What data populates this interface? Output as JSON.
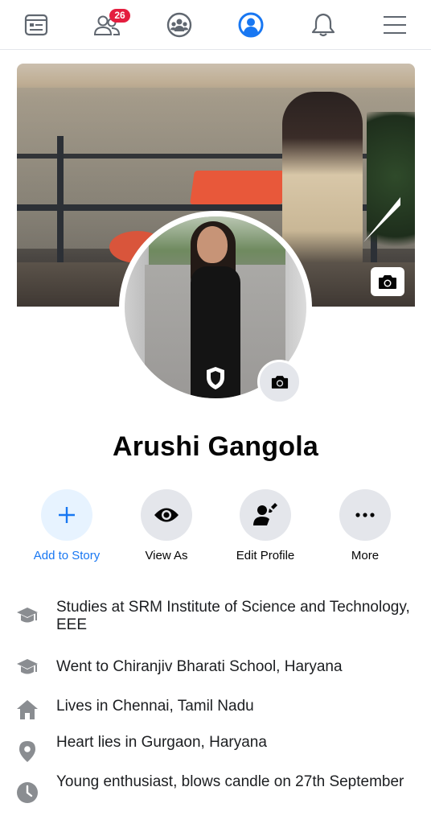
{
  "nav": {
    "items": [
      {
        "name": "news-feed-icon"
      },
      {
        "name": "friends-icon",
        "badge": "26"
      },
      {
        "name": "groups-icon"
      },
      {
        "name": "profile-icon",
        "active": true
      },
      {
        "name": "notifications-icon"
      },
      {
        "name": "menu-icon"
      }
    ],
    "accent_color": "#1877f2",
    "badge_color": "#e41e3f"
  },
  "profile": {
    "name": "Arushi Gangola"
  },
  "actions": [
    {
      "label": "Add to Story",
      "icon": "plus-icon"
    },
    {
      "label": "View As",
      "icon": "eye-icon"
    },
    {
      "label": "Edit Profile",
      "icon": "edit-person-icon"
    },
    {
      "label": "More",
      "icon": "more-dots-icon"
    }
  ],
  "details": [
    {
      "icon": "education-icon",
      "text": "Studies at SRM Institute of Science and Technology, EEE"
    },
    {
      "icon": "education-icon",
      "text": "Went to Chiranjiv Bharati School, Haryana"
    },
    {
      "icon": "home-icon",
      "text": "Lives in Chennai, Tamil Nadu"
    },
    {
      "icon": "location-pin-icon",
      "text": "Heart lies in Gurgaon, Haryana"
    },
    {
      "icon": "clock-icon",
      "text": "Young enthusiast, blows candle on 27th September"
    }
  ]
}
